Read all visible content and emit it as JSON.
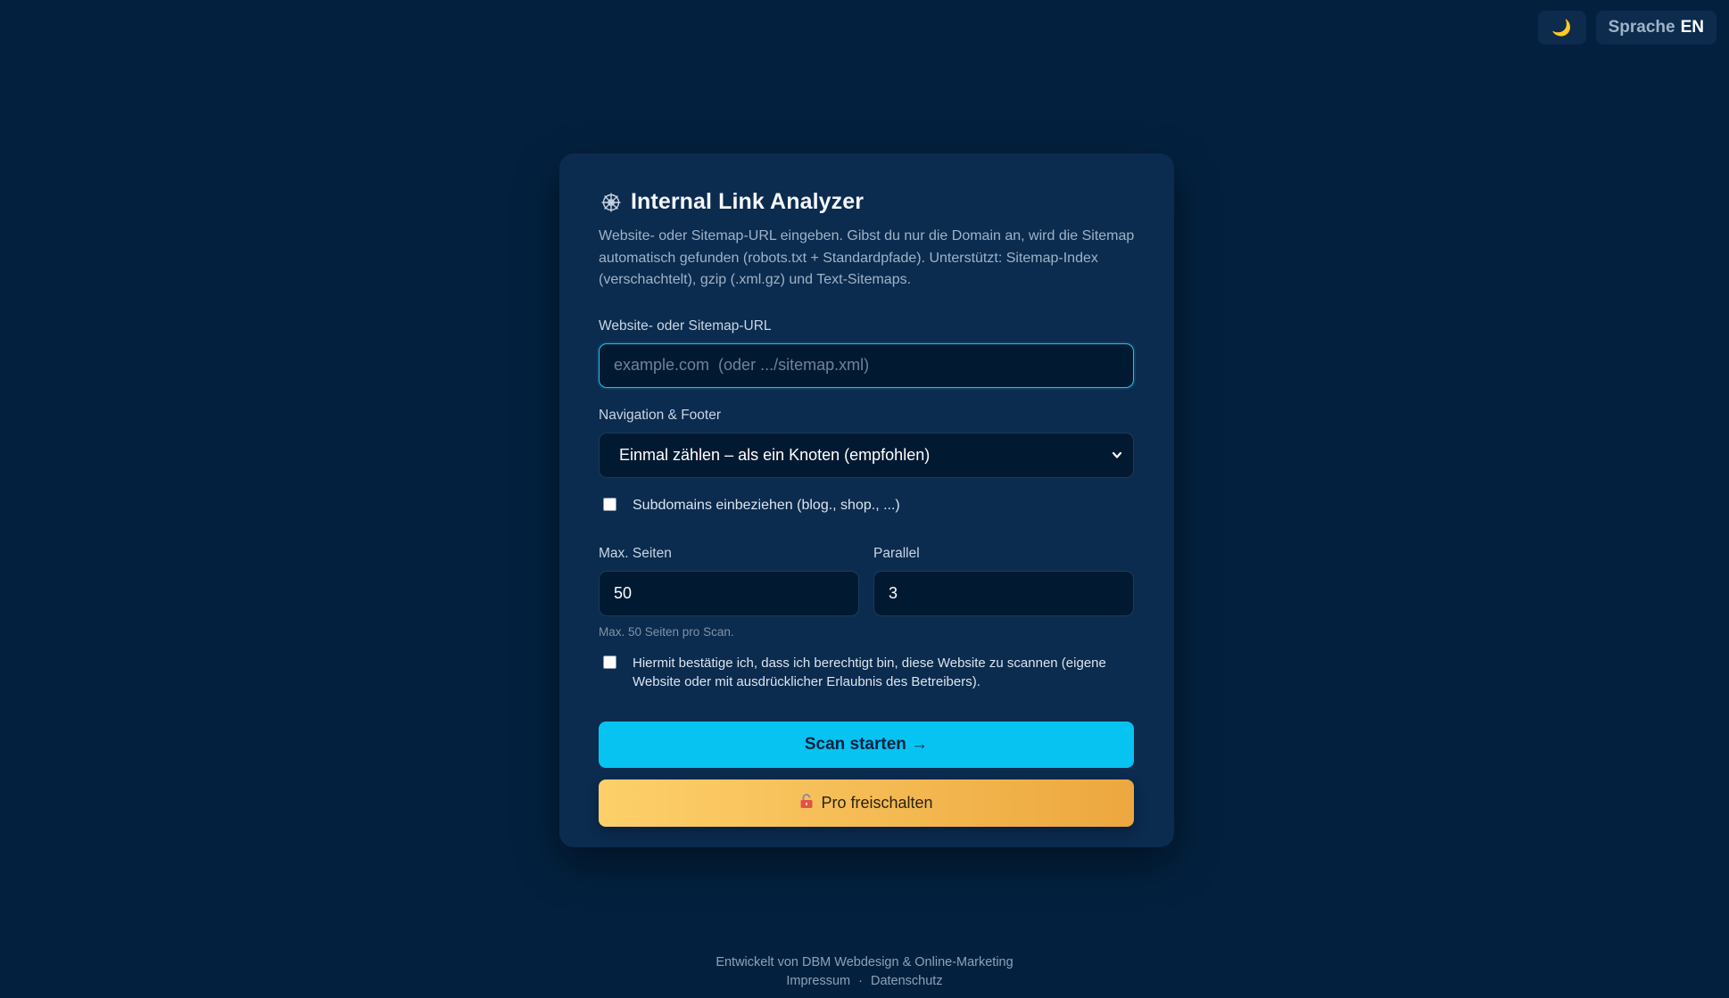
{
  "topbar": {
    "theme_icon": "moon-icon",
    "theme_glyph": "🌙",
    "language_label": "Sprache",
    "language_code": "EN"
  },
  "card": {
    "icon": "network-icon",
    "title": "Internal Link Analyzer",
    "description": "Website- oder Sitemap-URL eingeben. Gibst du nur die Domain an, wird die Sitemap automatisch gefunden (robots.txt + Standardpfade). Unterstützt: Sitemap-Index (verschachtelt), gzip (.xml.gz) und Text-Sitemaps.",
    "url_field": {
      "label": "Website- oder Sitemap-URL",
      "value": "",
      "placeholder": "example.com  (oder .../sitemap.xml)"
    },
    "nav_footer": {
      "label": "Navigation & Footer",
      "selected": "Einmal zählen – als ein Knoten (empfohlen)"
    },
    "subdomains": {
      "label": "Subdomains einbeziehen (blog., shop., ...)",
      "checked": false
    },
    "max_pages": {
      "label": "Max. Seiten",
      "value": "50"
    },
    "parallel": {
      "label": "Parallel",
      "value": "3"
    },
    "hint": "Max. 50 Seiten pro Scan.",
    "consent": {
      "label": "Hiermit bestätige ich, dass ich berechtigt bin, diese Website zu scannen (eigene Website oder mit ausdrücklicher Erlaubnis des Betreibers).",
      "checked": false
    },
    "scan_button": "Scan starten →",
    "pro_button": {
      "icon": "unlock-icon",
      "label": "Pro freischalten"
    }
  },
  "footer": {
    "credit": "Entwickelt von DBM Webdesign & Online-Marketing",
    "impressum": "Impressum",
    "separator": "·",
    "datenschutz": "Datenschutz"
  },
  "colors": {
    "background": "#03213f",
    "card": "#0b2b4f",
    "accent": "#06c3f1",
    "pro_gradient_start": "#fdd06a",
    "pro_gradient_end": "#eda73f"
  }
}
